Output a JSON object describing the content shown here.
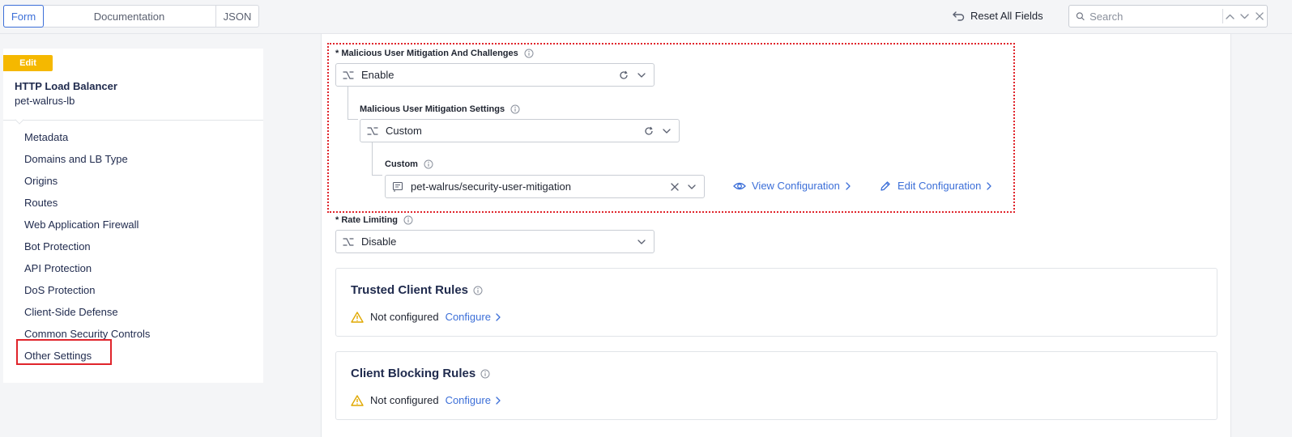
{
  "header": {
    "tabs": [
      {
        "label": "Form"
      },
      {
        "label": "Documentation"
      },
      {
        "label": "JSON"
      }
    ],
    "reset_label": "Reset All Fields",
    "search_placeholder": "Search"
  },
  "sidebar": {
    "badge": "Edit",
    "title": "HTTP Load Balancer",
    "subtitle": "pet-walrus-lb",
    "items": [
      {
        "label": "Metadata"
      },
      {
        "label": "Domains and LB Type"
      },
      {
        "label": "Origins"
      },
      {
        "label": "Routes"
      },
      {
        "label": "Web Application Firewall"
      },
      {
        "label": "Bot Protection"
      },
      {
        "label": "API Protection"
      },
      {
        "label": "DoS Protection"
      },
      {
        "label": "Client-Side Defense"
      },
      {
        "label": "Common Security Controls"
      },
      {
        "label": "Other Settings"
      }
    ]
  },
  "form": {
    "mitigation": {
      "label": "* Malicious User Mitigation And Challenges",
      "value": "Enable"
    },
    "settings": {
      "label": "Malicious User Mitigation Settings",
      "value": "Custom"
    },
    "custom": {
      "label": "Custom",
      "value": "pet-walrus/security-user-mitigation",
      "view_link": "View Configuration",
      "edit_link": "Edit Configuration"
    },
    "rate_limiting": {
      "label": "* Rate Limiting",
      "value": "Disable"
    }
  },
  "cards": [
    {
      "title": "Trusted Client Rules",
      "status": "Not configured",
      "action": "Configure"
    },
    {
      "title": "Client Blocking Rules",
      "status": "Not configured",
      "action": "Configure"
    }
  ],
  "colors": {
    "accent": "#3c6fd8",
    "badge": "#f5b800",
    "highlight": "#e0242b",
    "warning": "#f5b800"
  }
}
